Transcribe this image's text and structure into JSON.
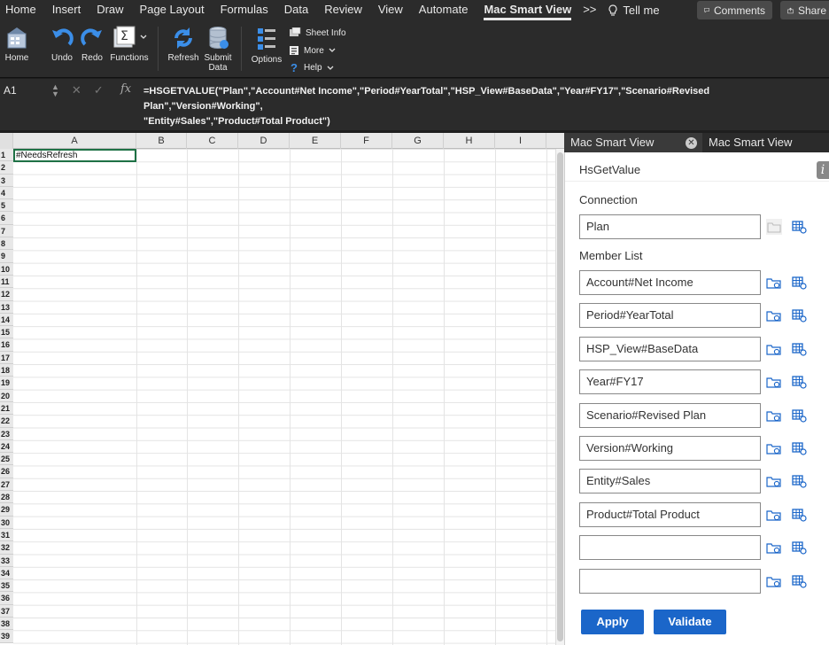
{
  "menu_tabs": [
    "Home",
    "Insert",
    "Draw",
    "Page Layout",
    "Formulas",
    "Data",
    "Review",
    "View",
    "Automate",
    "Mac Smart View"
  ],
  "overflow": ">>",
  "tell_me": "Tell me",
  "comments_label": "Comments",
  "share_label": "Share",
  "ribbon": {
    "home": "Home",
    "undo": "Undo",
    "redo": "Redo",
    "functions": "Functions",
    "refresh": "Refresh",
    "submit_line1": "Submit",
    "submit_line2": "Data",
    "options": "Options",
    "sheet_info": "Sheet Info",
    "more": "More",
    "help": "Help"
  },
  "formula_bar": {
    "name_box": "A1",
    "fx": "fx",
    "formula_line1": "=HSGETVALUE(\"Plan\",\"Account#Net Income\",\"Period#YearTotal\",\"HSP_View#BaseData\",\"Year#FY17\",\"Scenario#Revised Plan\",\"Version#Working\",",
    "formula_line2": "\"Entity#Sales\",\"Product#Total Product\")"
  },
  "sheet": {
    "columns": [
      "A",
      "B",
      "C",
      "D",
      "E",
      "F",
      "G",
      "H",
      "I"
    ],
    "rows": [
      "1",
      "2",
      "3",
      "4",
      "5",
      "6",
      "7",
      "8",
      "9",
      "10",
      "11",
      "12",
      "13",
      "14",
      "15",
      "16",
      "17",
      "18",
      "19",
      "20",
      "21",
      "22",
      "23",
      "24",
      "25",
      "26",
      "27",
      "28",
      "29",
      "30",
      "31",
      "32",
      "33",
      "34",
      "35",
      "36",
      "37",
      "38",
      "39"
    ],
    "a1_value": "#NeedsRefresh"
  },
  "panel": {
    "tab_active": "Mac Smart View",
    "tab_other": "Mac Smart View",
    "title": "HsGetValue",
    "info_glyph": "i",
    "connection_label": "Connection",
    "connection_value": "Plan",
    "member_list_label": "Member List",
    "members": [
      "Account#Net Income",
      "Period#YearTotal",
      "HSP_View#BaseData",
      "Year#FY17",
      "Scenario#Revised Plan",
      "Version#Working",
      "Entity#Sales",
      "Product#Total Product",
      "",
      ""
    ],
    "apply_label": "Apply",
    "validate_label": "Validate"
  },
  "colors": {
    "accent": "#1b66c9",
    "selection": "#1e7145"
  }
}
